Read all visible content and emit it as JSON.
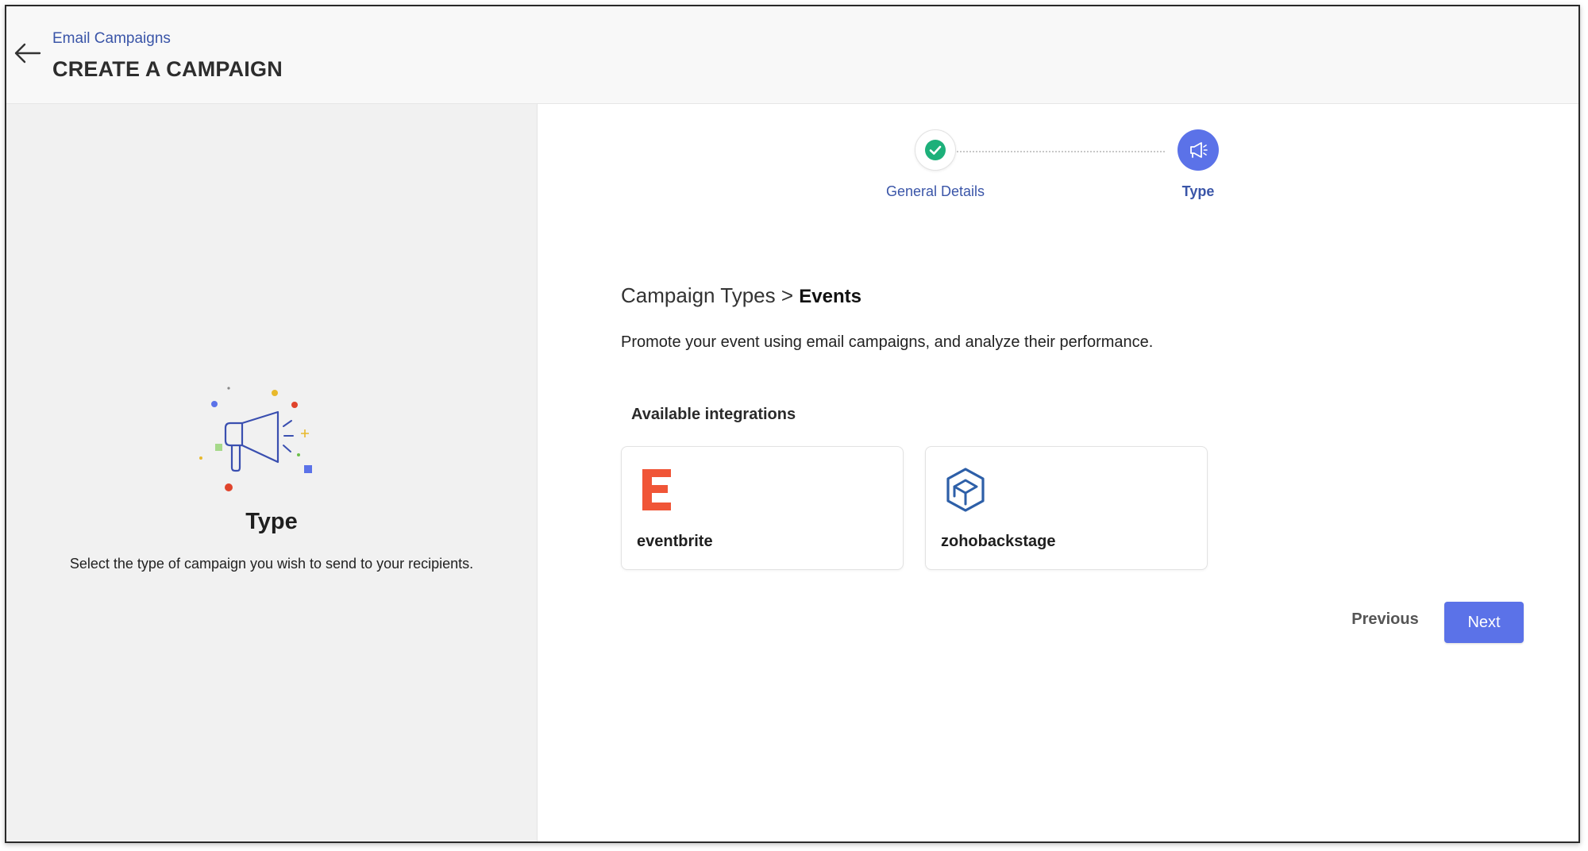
{
  "header": {
    "breadcrumb": "Email Campaigns",
    "title": "CREATE A CAMPAIGN"
  },
  "left_panel": {
    "title": "Type",
    "description": "Select the type of campaign you wish to send to your recipients.",
    "illustration_icon": "megaphone-icon"
  },
  "stepper": {
    "steps": [
      {
        "label": "General Details",
        "status": "completed",
        "icon": "check-icon"
      },
      {
        "label": "Type",
        "status": "active",
        "icon": "megaphone-icon"
      }
    ]
  },
  "main": {
    "heading_prefix": "Campaign Types >",
    "heading_current": "Events",
    "description": "Promote your event using email campaigns, and analyze their performance.",
    "integrations_label": "Available integrations",
    "integrations": [
      {
        "name": "eventbrite",
        "icon": "eventbrite-logo",
        "color": "#f05537"
      },
      {
        "name": "zohobackstage",
        "icon": "zohobackstage-logo",
        "color": "#2d5fa8"
      }
    ]
  },
  "actions": {
    "previous_label": "Previous",
    "next_label": "Next"
  },
  "colors": {
    "accent": "#5b72e8",
    "link": "#3a55a8",
    "success": "#1db07a"
  }
}
